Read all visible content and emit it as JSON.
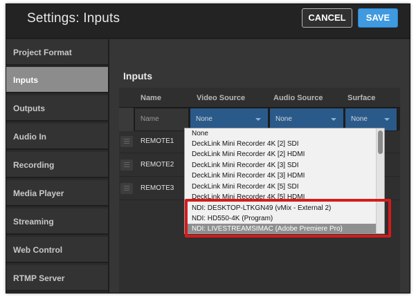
{
  "window": {
    "title": "Settings: Inputs",
    "cancel_label": "CANCEL",
    "save_label": "SAVE"
  },
  "sidebar": {
    "items": [
      {
        "label": "Project Format"
      },
      {
        "label": "Inputs",
        "active": true
      },
      {
        "label": "Outputs"
      },
      {
        "label": "Audio In"
      },
      {
        "label": "Recording"
      },
      {
        "label": "Media Player"
      },
      {
        "label": "Streaming"
      },
      {
        "label": "Web Control"
      },
      {
        "label": "RTMP Server"
      }
    ]
  },
  "inputs": {
    "title": "Inputs",
    "columns": [
      "Name",
      "Video Source",
      "Audio Source",
      "Surface"
    ],
    "filters": {
      "name_placeholder": "Name",
      "video": "None",
      "audio": "None",
      "surface": "None"
    },
    "rows": [
      {
        "name": "REMOTE1"
      },
      {
        "name": "REMOTE2"
      },
      {
        "name": "REMOTE3"
      }
    ]
  },
  "dropdown": {
    "options": [
      "None",
      "DeckLink Mini Recorder 4K [2] SDI",
      "DeckLink Mini Recorder 4K [2] HDMI",
      "DeckLink Mini Recorder 4K [3] SDI",
      "DeckLink Mini Recorder 4K [3] HDMI",
      "DeckLink Mini Recorder 4K [5] SDI",
      "DeckLink Mini Recorder 4K [5] HDMI",
      "NDI: DESKTOP-LTKGN49 (vMix - External 2)",
      "NDI: HD550-4K (Program)",
      "NDI: LIVESTREAMSIMAC (Adobe Premiere Pro)"
    ],
    "selected_option": "NDI: LIVESTREAMSIMAC (Adobe Premiere Pro)"
  },
  "colors": {
    "accent": "#3f9ae0",
    "highlight_border": "#d61a1a",
    "filter_bg": "#2a5a8a"
  }
}
